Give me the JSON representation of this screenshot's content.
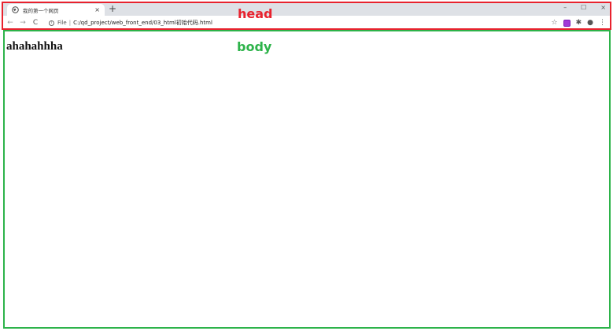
{
  "browser": {
    "tab_title": "我的第一个网页",
    "tab_close": "×",
    "new_tab": "+",
    "window_controls": {
      "minimize": "–",
      "maximize": "☐",
      "close": "×"
    },
    "nav": {
      "back": "←",
      "forward": "→",
      "reload": "C"
    },
    "omnibox": {
      "info": "i",
      "scheme": "File",
      "separator": "|",
      "url": "C:/qd_project/web_front_end/03_html初始代码.html"
    },
    "toolbar_icons": {
      "star": "☆",
      "puzzle": "✱",
      "profile": "●",
      "menu": "⋮"
    }
  },
  "annotations": {
    "head_label": "head",
    "body_label": "body",
    "head_color": "#e8222e",
    "body_color": "#2db34a"
  },
  "page": {
    "heading": "ahahahhha"
  }
}
